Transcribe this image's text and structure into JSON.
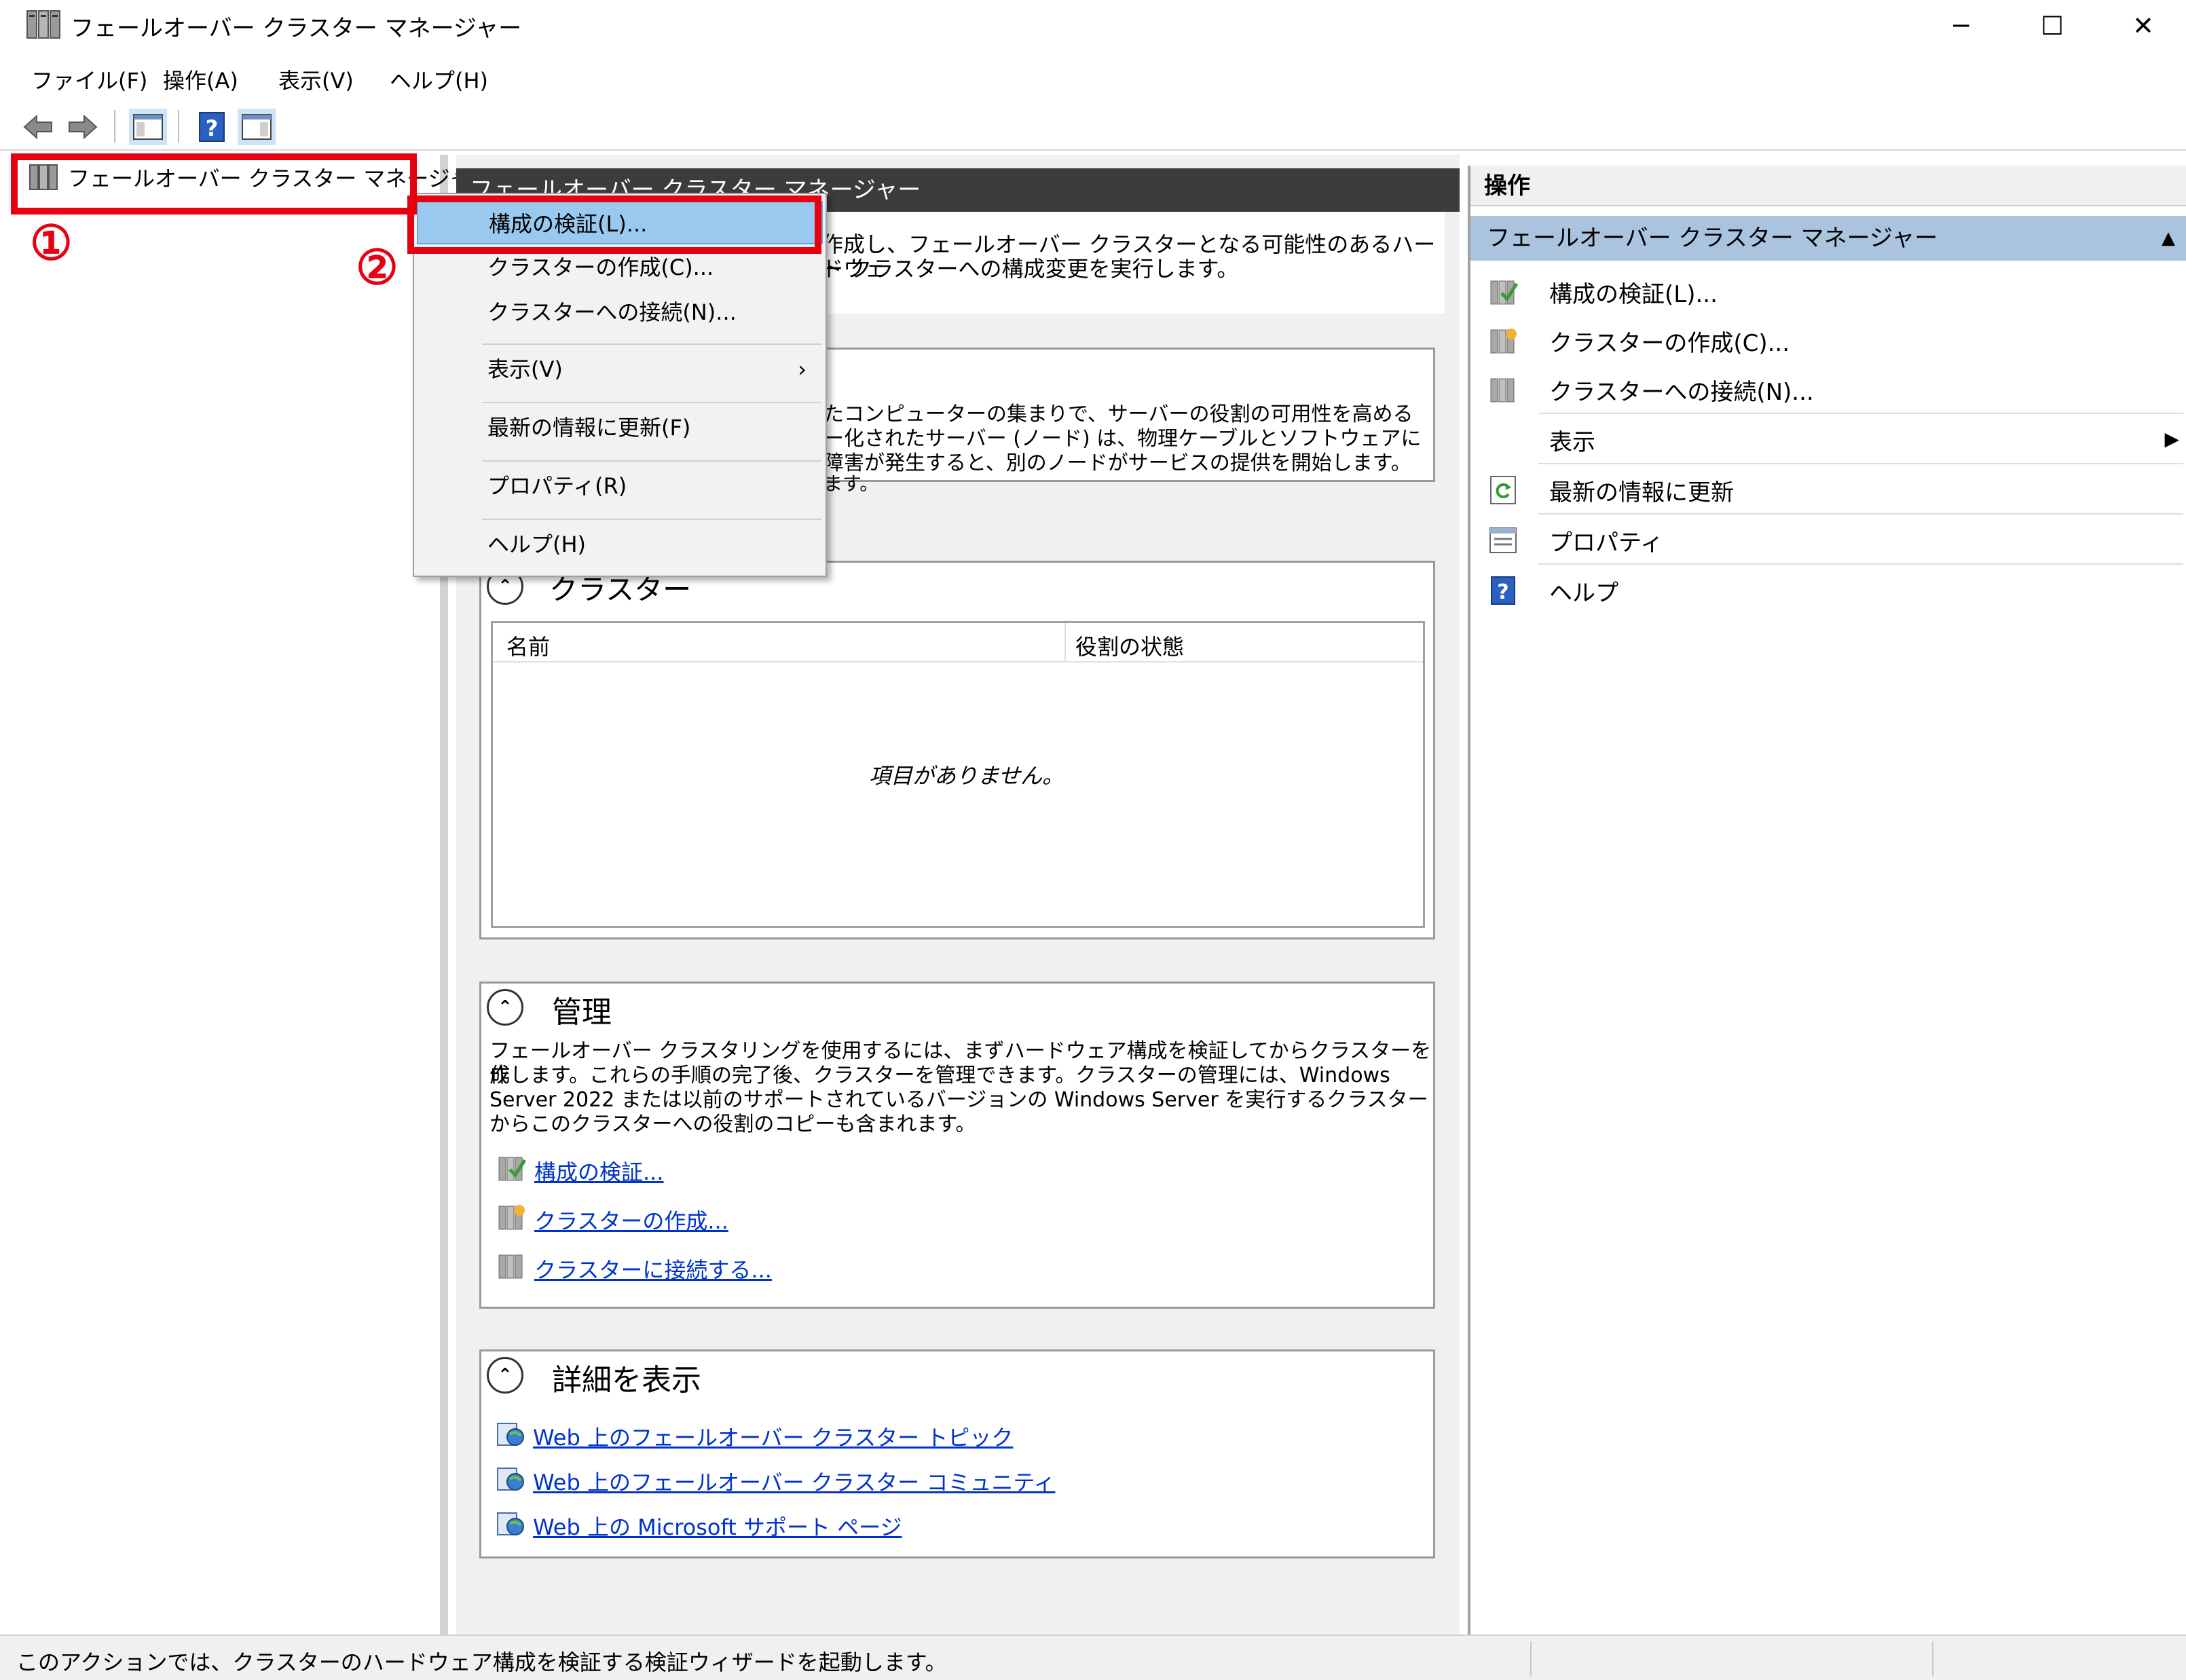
{
  "window": {
    "title": "フェールオーバー クラスター マネージャー",
    "minimize": "─",
    "maximize": "☐",
    "close": "✕"
  },
  "menubar": {
    "file": "ファイル(F)",
    "action": "操作(A)",
    "view": "表示(V)",
    "help": "ヘルプ(H)"
  },
  "tree": {
    "root_label": "フェールオーバー クラスター マネージャー"
  },
  "annotations": {
    "step1": "①",
    "step2": "②",
    "highlight_color": "#e60012"
  },
  "context_menu": {
    "validate": "構成の検証(L)...",
    "create": "クラスターの作成(C)...",
    "connect": "クラスターへの接続(N)...",
    "view": "表示(V)",
    "view_arrow": "›",
    "refresh": "最新の情報に更新(F)",
    "properties": "プロパティ(R)",
    "help": "ヘルプ(H)"
  },
  "center": {
    "header": "フェールオーバー クラスター マネージャー",
    "intro_line1": "作成し、フェールオーバー クラスターとなる可能性のあるハードウェ",
    "intro_line2": "ー クラスターへの構成変更を実行します。",
    "overview_line1": "たコンピューターの集まりで、サーバーの役割の可用性を高める",
    "overview_line2": "ー化されたサーバー (ノード) は、物理ケーブルとソフトウェアに",
    "overview_line3": "障害が発生すると、別のノードがサービスの提供を開始します。",
    "overview_line4": "ます。",
    "clusters": {
      "title": "クラスター",
      "col_name": "名前",
      "col_state": "役割の状態",
      "empty": "項目がありません。"
    },
    "management": {
      "title": "管理",
      "line1": "フェールオーバー クラスタリングを使用するには、まずハードウェア構成を検証してからクラスターを作",
      "line2": "成します。これらの手順の完了後、クラスターを管理できます。クラスターの管理には、Windows",
      "line3": "Server 2022 または以前のサポートされているバージョンの Windows Server を実行するクラスター",
      "line4": "からこのクラスターへの役割のコピーも含まれます。",
      "link_validate": "構成の検証...",
      "link_create": "クラスターの作成...",
      "link_connect": "クラスターに接続する..."
    },
    "more_info": {
      "title": "詳細を表示",
      "link_topics": "Web 上のフェールオーバー クラスター トピック",
      "link_community": "Web 上のフェールオーバー クラスター コミュニティ",
      "link_support": "Web 上の Microsoft サポート ページ"
    }
  },
  "actions": {
    "header": "操作",
    "section": "フェールオーバー クラスター マネージャー",
    "section_arrow": "▲",
    "validate": "構成の検証(L)...",
    "create": "クラスターの作成(C)...",
    "connect": "クラスターへの接続(N)...",
    "view": "表示",
    "view_arrow": "▶",
    "refresh": "最新の情報に更新",
    "properties": "プロパティ",
    "help": "ヘルプ"
  },
  "status": {
    "text": "このアクションでは、クラスターのハードウェア構成を検証する検証ウィザードを起動します。"
  },
  "colors": {
    "section_highlight": "#aac4e0",
    "menu_highlight": "#99c9ef",
    "link": "#0033cc"
  }
}
